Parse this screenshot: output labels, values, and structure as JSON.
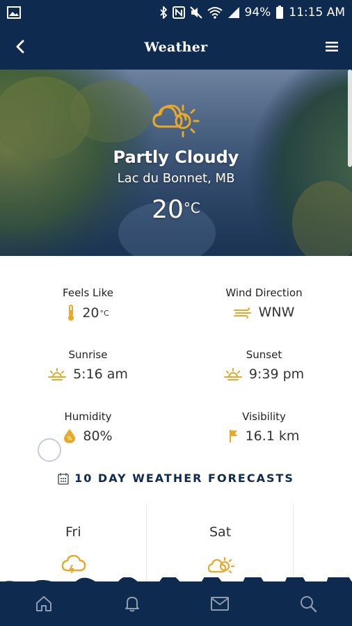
{
  "status_bar": {
    "battery": "94%",
    "time": "11:15 AM",
    "icons": [
      "image-icon",
      "bluetooth-icon",
      "nfc-icon",
      "mute-icon",
      "wifi-icon",
      "signal-icon",
      "battery-icon"
    ]
  },
  "app_bar": {
    "title": "Weather",
    "back_icon": "chevron-left-icon",
    "menu_icon": "hamburger-menu-icon"
  },
  "current": {
    "condition": "Partly Cloudy",
    "location": "Lac du Bonnet, MB",
    "temp": "20",
    "temp_unit": "°C",
    "icon": "partly-cloudy-icon"
  },
  "details": {
    "feels_like": {
      "label": "Feels Like",
      "value": "20",
      "unit": "°C",
      "icon": "thermometer-icon"
    },
    "wind_direction": {
      "label": "Wind Direction",
      "value": "WNW",
      "icon": "wind-icon"
    },
    "sunrise": {
      "label": "Sunrise",
      "value": "5:16 am",
      "icon": "sunrise-icon"
    },
    "sunset": {
      "label": "Sunset",
      "value": "9:39 pm",
      "icon": "sunset-icon"
    },
    "humidity": {
      "label": "Humidity",
      "value": "80%",
      "icon": "humidity-icon"
    },
    "visibility": {
      "label": "Visibility",
      "value": "16.1 km",
      "icon": "flag-icon"
    }
  },
  "forecast": {
    "heading": "10 DAY WEATHER FORECASTS",
    "heading_icon": "calendar-icon",
    "days": [
      {
        "day": "Fri",
        "icon": "rain-cloud-icon"
      },
      {
        "day": "Sat",
        "icon": "partly-cloudy-icon"
      }
    ]
  },
  "bottom_nav": {
    "items": [
      "home-icon",
      "bell-icon",
      "mail-icon",
      "search-icon"
    ]
  },
  "colors": {
    "navy": "#0f2a4f",
    "accent": "#e8a82a",
    "text": "#333333"
  }
}
